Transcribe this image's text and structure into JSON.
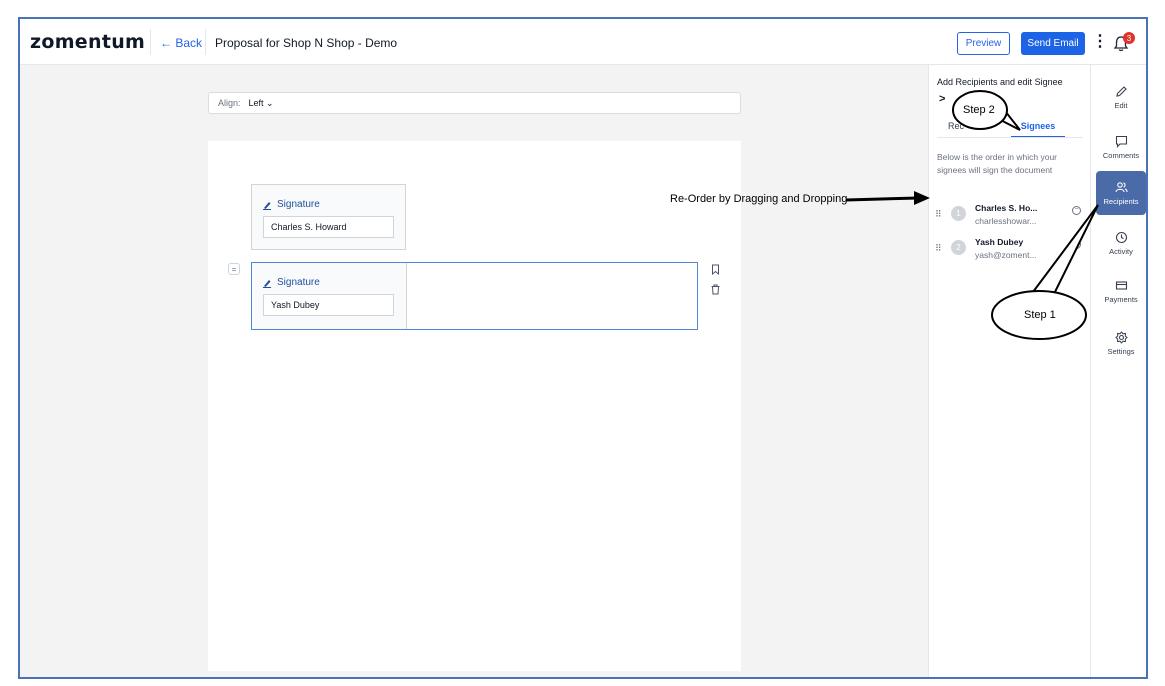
{
  "header": {
    "logo": "zomentum",
    "back_label": "← Back",
    "doc_title": "Proposal for Shop N Shop - Demo",
    "preview_label": "Preview",
    "send_label": "Send Email",
    "kebab": "⋮",
    "notif_count": "3"
  },
  "toolbar": {
    "align_label": "Align:",
    "align_value": "Left ⌄"
  },
  "canvas": {
    "blocks": [
      {
        "label": "Signature",
        "name": "Charles S. Howard"
      },
      {
        "label": "Signature",
        "name": "Yash Dubey"
      }
    ],
    "drag_glyph": "="
  },
  "panel": {
    "title": "Add Recipients and edit Signee",
    "chevron": ">",
    "tab_recipients": "Rec",
    "tab_signees": "Signees",
    "description": "Below is the order in which your signees will sign the document",
    "signees": [
      {
        "order": "1",
        "name": "Charles S. Ho...",
        "email": "charlesshowar..."
      },
      {
        "order": "2",
        "name": "Yash Dubey",
        "email": "yash@zoment..."
      }
    ]
  },
  "rail": {
    "items": [
      {
        "label": "Edit",
        "icon": "pencil-icon"
      },
      {
        "label": "Comments",
        "icon": "comment-icon"
      },
      {
        "label": "Recipients",
        "icon": "users-icon"
      },
      {
        "label": "Activity",
        "icon": "clock-icon"
      },
      {
        "label": "Payments",
        "icon": "card-icon"
      },
      {
        "label": "Settings",
        "icon": "gear-icon"
      }
    ]
  },
  "annotations": {
    "step1": "Step 1",
    "step2": "Step 2",
    "reorder": "Re-Order by Dragging and Dropping"
  },
  "colors": {
    "accent": "#1d63e6",
    "rail_active": "#4a6aa8",
    "frame_border": "#4a72b8",
    "badge": "#e0312a"
  }
}
